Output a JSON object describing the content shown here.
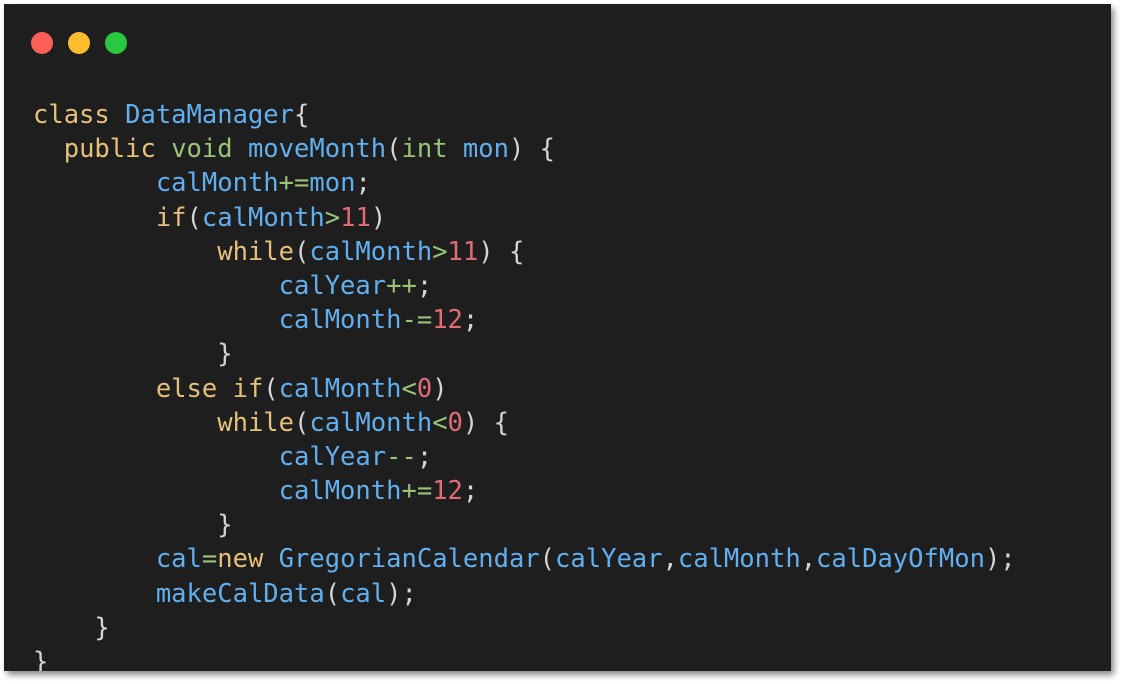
{
  "window": {
    "controls": [
      {
        "name": "close",
        "color": "#ff5f57"
      },
      {
        "name": "minimize",
        "color": "#febc2e"
      },
      {
        "name": "maximize",
        "color": "#28c840"
      }
    ]
  },
  "colors": {
    "background": "#1e1e1e",
    "keyword": "#e5c07b",
    "type": "#98c379",
    "identifier": "#61afef",
    "number": "#e06c75",
    "operator": "#98c379",
    "punctuation": "#d4d4d4"
  },
  "code": {
    "lines": [
      [
        [
          "kw",
          "class "
        ],
        [
          "id",
          "DataManager"
        ],
        [
          "pun",
          "{"
        ]
      ],
      [
        [
          "pun",
          "  "
        ],
        [
          "kw",
          "public "
        ],
        [
          "type",
          "void "
        ],
        [
          "fn",
          "moveMonth"
        ],
        [
          "pun",
          "("
        ],
        [
          "type",
          "int "
        ],
        [
          "id",
          "mon"
        ],
        [
          "pun",
          ") {"
        ]
      ],
      [
        [
          "pun",
          "        "
        ],
        [
          "id",
          "calMonth"
        ],
        [
          "op",
          "+="
        ],
        [
          "id",
          "mon"
        ],
        [
          "pun",
          ";"
        ]
      ],
      [
        [
          "pun",
          "        "
        ],
        [
          "kw",
          "if"
        ],
        [
          "pun",
          "("
        ],
        [
          "id",
          "calMonth"
        ],
        [
          "op",
          ">"
        ],
        [
          "num",
          "11"
        ],
        [
          "pun",
          ")"
        ]
      ],
      [
        [
          "pun",
          "            "
        ],
        [
          "kw",
          "while"
        ],
        [
          "pun",
          "("
        ],
        [
          "id",
          "calMonth"
        ],
        [
          "op",
          ">"
        ],
        [
          "num",
          "11"
        ],
        [
          "pun",
          ") {"
        ]
      ],
      [
        [
          "pun",
          "                "
        ],
        [
          "id",
          "calYear"
        ],
        [
          "op",
          "++"
        ],
        [
          "pun",
          ";"
        ]
      ],
      [
        [
          "pun",
          "                "
        ],
        [
          "id",
          "calMonth"
        ],
        [
          "op",
          "-="
        ],
        [
          "num",
          "12"
        ],
        [
          "pun",
          ";"
        ]
      ],
      [
        [
          "pun",
          "            }"
        ]
      ],
      [
        [
          "pun",
          "        "
        ],
        [
          "kw",
          "else if"
        ],
        [
          "pun",
          "("
        ],
        [
          "id",
          "calMonth"
        ],
        [
          "op",
          "<"
        ],
        [
          "num",
          "0"
        ],
        [
          "pun",
          ")"
        ]
      ],
      [
        [
          "pun",
          "            "
        ],
        [
          "kw",
          "while"
        ],
        [
          "pun",
          "("
        ],
        [
          "id",
          "calMonth"
        ],
        [
          "op",
          "<"
        ],
        [
          "num",
          "0"
        ],
        [
          "pun",
          ") {"
        ]
      ],
      [
        [
          "pun",
          "                "
        ],
        [
          "id",
          "calYear"
        ],
        [
          "op",
          "--"
        ],
        [
          "pun",
          ";"
        ]
      ],
      [
        [
          "pun",
          "                "
        ],
        [
          "id",
          "calMonth"
        ],
        [
          "op",
          "+="
        ],
        [
          "num",
          "12"
        ],
        [
          "pun",
          ";"
        ]
      ],
      [
        [
          "pun",
          "            }"
        ]
      ],
      [
        [
          "pun",
          "        "
        ],
        [
          "id",
          "cal"
        ],
        [
          "op",
          "="
        ],
        [
          "kw",
          "new "
        ],
        [
          "id",
          "GregorianCalendar"
        ],
        [
          "pun",
          "("
        ],
        [
          "id",
          "calYear"
        ],
        [
          "pun",
          ","
        ],
        [
          "id",
          "calMonth"
        ],
        [
          "pun",
          ","
        ],
        [
          "id",
          "calDayOfMon"
        ],
        [
          "pun",
          ");"
        ]
      ],
      [
        [
          "pun",
          "        "
        ],
        [
          "fn",
          "makeCalData"
        ],
        [
          "pun",
          "("
        ],
        [
          "id",
          "cal"
        ],
        [
          "pun",
          ");"
        ]
      ],
      [
        [
          "pun",
          "    }"
        ]
      ],
      [
        [
          "pun",
          "}"
        ]
      ]
    ]
  }
}
